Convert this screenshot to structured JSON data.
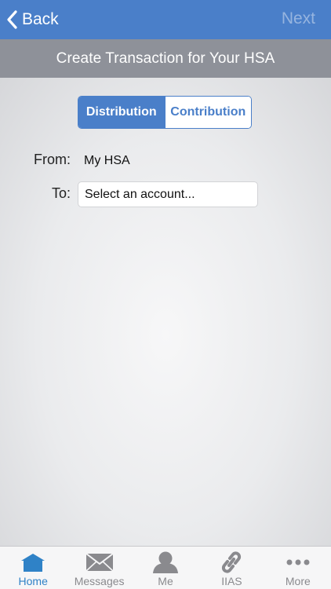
{
  "navbar": {
    "back_label": "Back",
    "next_label": "Next"
  },
  "title": "Create Transaction for Your HSA",
  "segments": {
    "distribution": "Distribution",
    "contribution": "Contribution",
    "selected": "Distribution"
  },
  "form": {
    "from_label": "From:",
    "from_value": "My HSA",
    "to_label": "To:",
    "to_value": "Select an account..."
  },
  "tabs": [
    {
      "label": "Home",
      "icon": "home-icon",
      "active": true
    },
    {
      "label": "Messages",
      "icon": "envelope-icon",
      "active": false
    },
    {
      "label": "Me",
      "icon": "person-icon",
      "active": false
    },
    {
      "label": "IIAS",
      "icon": "link-icon",
      "active": false
    },
    {
      "label": "More",
      "icon": "ellipsis-icon",
      "active": false
    }
  ],
  "colors": {
    "accent": "#4a7fc9",
    "title_bar": "#8e9199",
    "tab_active": "#2f82c7",
    "tab_inactive": "#8a8a8e"
  }
}
